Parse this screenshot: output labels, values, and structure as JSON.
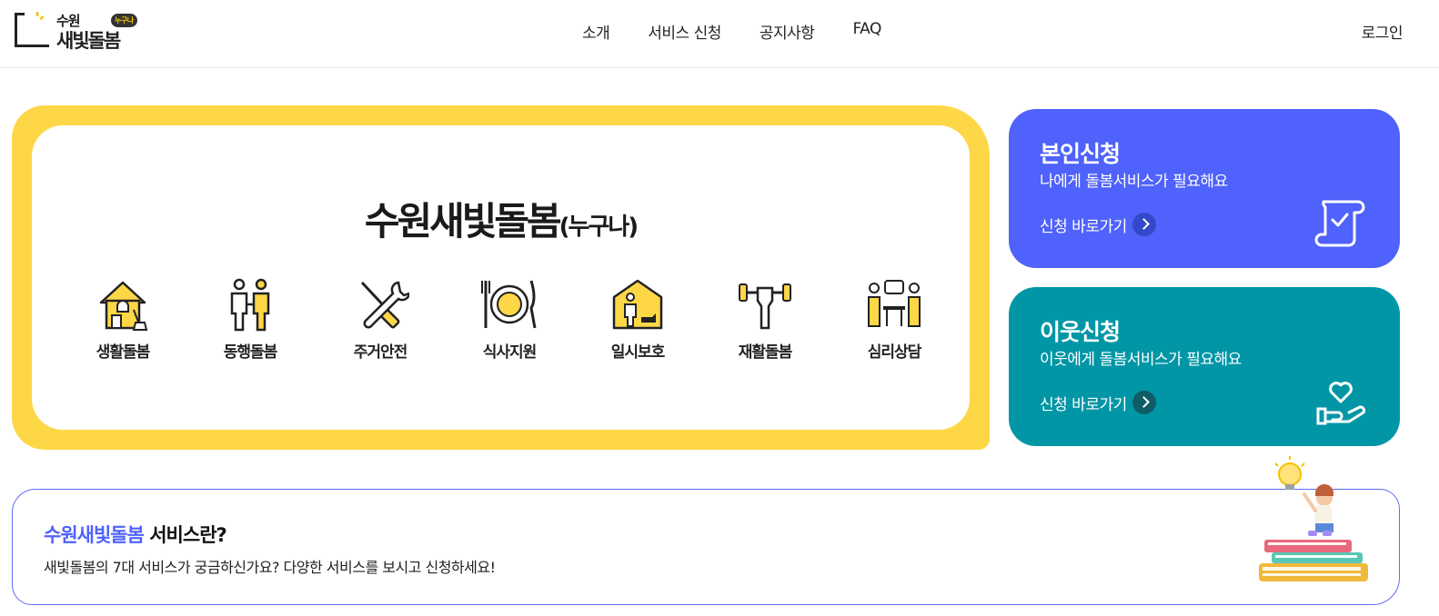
{
  "header": {
    "logo": {
      "line1": "수원",
      "line2": "새빛돌봄",
      "badge": "누구나"
    },
    "nav": [
      "소개",
      "서비스 신청",
      "공지사항",
      "FAQ"
    ],
    "login": "로그인"
  },
  "hero": {
    "title_main": "수원새빛돌봄",
    "title_sub": "(누구나)",
    "services": [
      {
        "label": "생활돌봄",
        "icon": "house-broom-icon"
      },
      {
        "label": "동행돌봄",
        "icon": "two-people-holding-hands-icon"
      },
      {
        "label": "주거안전",
        "icon": "screwdriver-wrench-icon"
      },
      {
        "label": "식사지원",
        "icon": "fork-plate-knife-icon"
      },
      {
        "label": "일시보호",
        "icon": "house-person-dog-icon"
      },
      {
        "label": "재활돌봄",
        "icon": "dumbbell-arm-icon"
      },
      {
        "label": "심리상담",
        "icon": "counseling-people-icon"
      }
    ]
  },
  "cards": {
    "self": {
      "title": "본인신청",
      "desc": "나에게 돌봄서비스가 필요해요",
      "link": "신청 바로가기",
      "color": "#4f62fb",
      "icon": "document-check-icon"
    },
    "neighbor": {
      "title": "이웃신청",
      "desc": "이웃에게 돌봄서비스가 필요해요",
      "link": "신청 바로가기",
      "color": "#0096a6",
      "icon": "heart-hand-icon"
    }
  },
  "info": {
    "title_accent": "수원새빛돌봄",
    "title_rest": " 서비스란?",
    "desc": "새빛돌봄의 7대 서비스가 궁금하신가요? 다양한 서비스를 보시고 신청하세요!"
  },
  "colors": {
    "yellow": "#fed747",
    "blue": "#4f62fb",
    "teal": "#0096a6"
  }
}
